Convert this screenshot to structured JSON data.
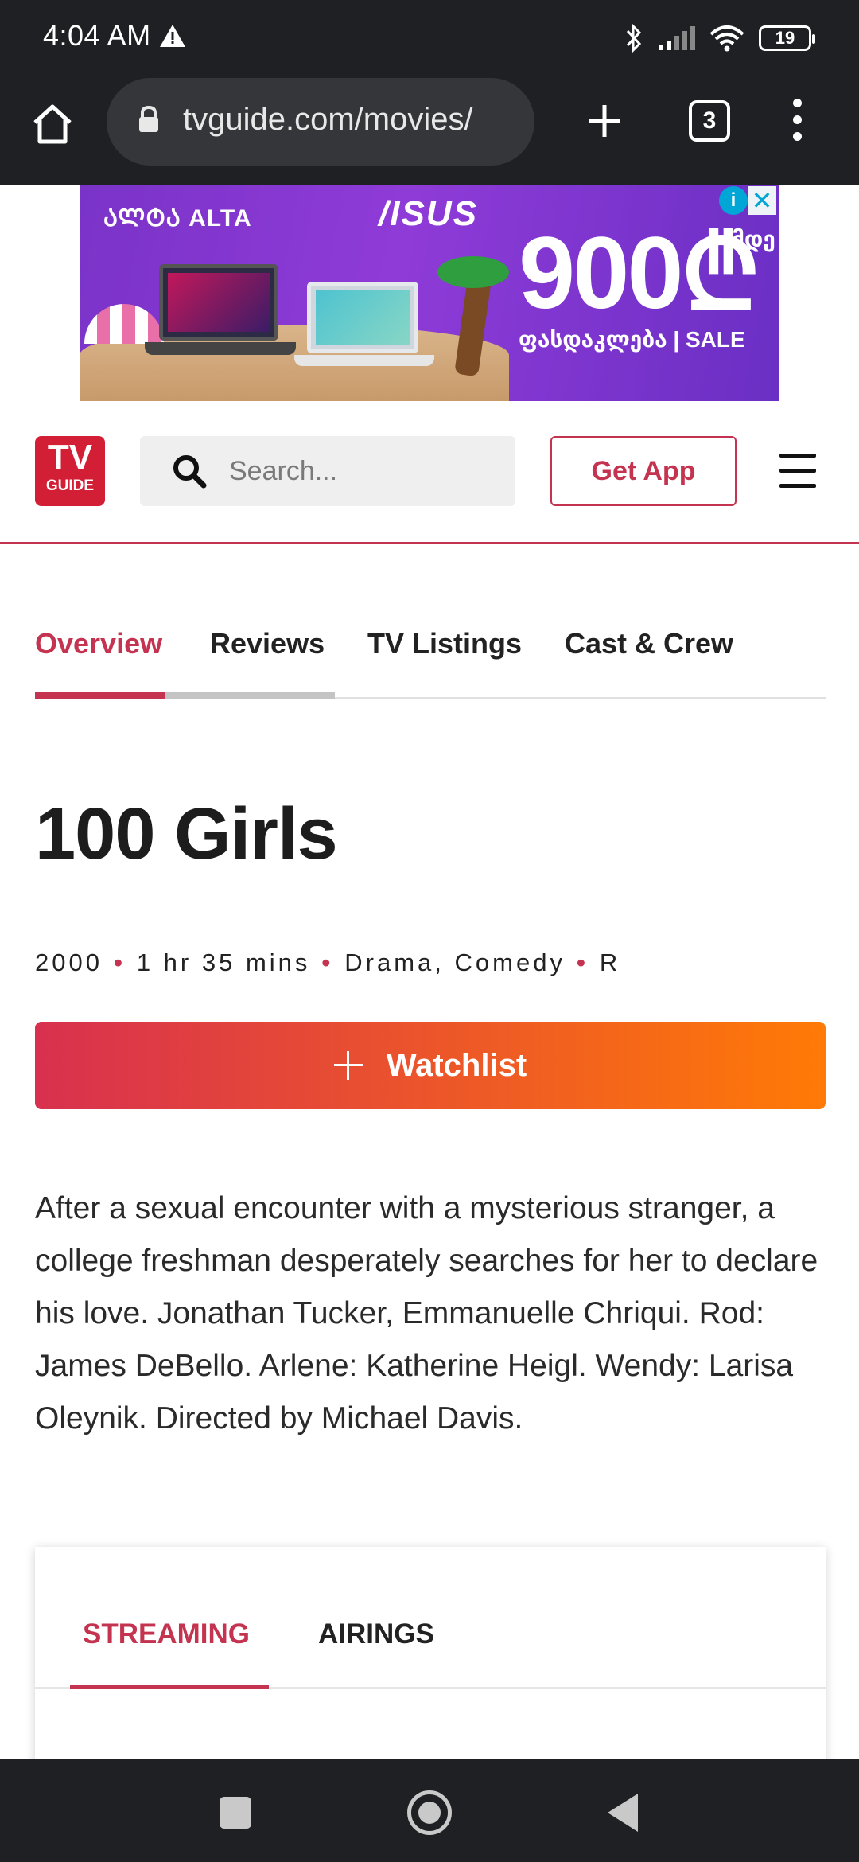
{
  "status_bar": {
    "time": "4:04 AM",
    "battery": "19"
  },
  "browser": {
    "url": "tvguide.com/movies/",
    "tab_count": "3"
  },
  "ad": {
    "brand": "ᲐᲚᲢᲐ ALTA",
    "partner": "/ISUS",
    "price": "900₾",
    "price_unit": "მდე",
    "sale_text": "ფასდაკლება | SALE",
    "info_label": "i",
    "close_label": "✕"
  },
  "header": {
    "logo_top": "TV",
    "logo_bottom": "GUIDE",
    "search_placeholder": "Search...",
    "get_app_label": "Get App"
  },
  "tabs": [
    {
      "label": "Overview",
      "active": true
    },
    {
      "label": "Reviews",
      "active": false
    },
    {
      "label": "TV Listings",
      "active": false
    },
    {
      "label": "Cast & Crew",
      "active": false
    }
  ],
  "movie": {
    "title": "100 Girls",
    "year": "2000",
    "runtime": "1 hr 35 mins",
    "genres": "Drama, Comedy",
    "rating": "R",
    "meta_separator": "•",
    "watchlist_label": "Watchlist",
    "synopsis": "After a sexual encounter with a mysterious stranger, a college freshman desperately searches for her to declare his love. Jonathan Tucker, Emmanuelle Chriqui. Rod: James DeBello. Arlene: Katherine Heigl. Wendy: Larisa Oleynik. Directed by Michael Davis."
  },
  "watch_card": {
    "tabs": [
      {
        "label": "STREAMING",
        "active": true
      },
      {
        "label": "AIRINGS",
        "active": false
      }
    ]
  },
  "colors": {
    "brand": "#c4334f",
    "watchlist_gradient_start": "#d8304f",
    "watchlist_gradient_end": "#ff7a06",
    "system_bar": "#1f2023"
  },
  "icons": [
    "alert-icon",
    "bluetooth-icon",
    "signal-icon",
    "wifi-icon",
    "battery-icon",
    "home-icon",
    "lock-icon",
    "plus-icon",
    "tabs-icon",
    "more-icon",
    "search-icon",
    "hamburger-icon",
    "recents-icon",
    "nav-home-icon",
    "back-icon"
  ]
}
